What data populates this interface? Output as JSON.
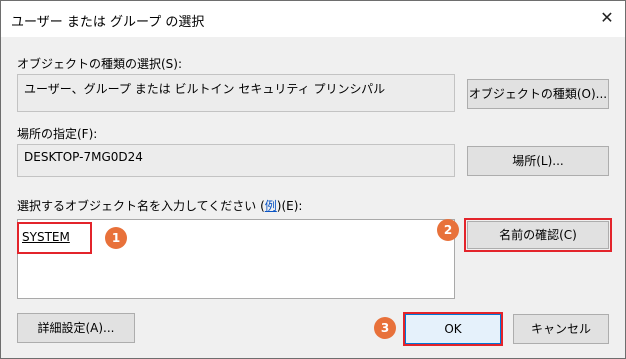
{
  "window": {
    "title": "ユーザー または グループ の選択",
    "close_symbol": "✕"
  },
  "object_type": {
    "label": "オブジェクトの種類の選択(S):",
    "value": "ユーザー、グループ または ビルトイン セキュリティ プリンシパル",
    "button": "オブジェクトの種類(O)..."
  },
  "location": {
    "label": "場所の指定(F):",
    "value": "DESKTOP-7MG0D24",
    "button": "場所(L)..."
  },
  "names": {
    "label_prefix": "選択するオブジェクト名を入力してください (",
    "label_link": "例",
    "label_suffix": ")(E):",
    "value": "SYSTEM",
    "check_button": "名前の確認(C)"
  },
  "buttons": {
    "advanced": "詳細設定(A)...",
    "ok": "OK",
    "cancel": "キャンセル"
  },
  "badges": [
    "1",
    "2",
    "3"
  ],
  "colors": {
    "highlight": "#e3242b",
    "badge": "#e8713a",
    "link": "#0a54c4"
  }
}
